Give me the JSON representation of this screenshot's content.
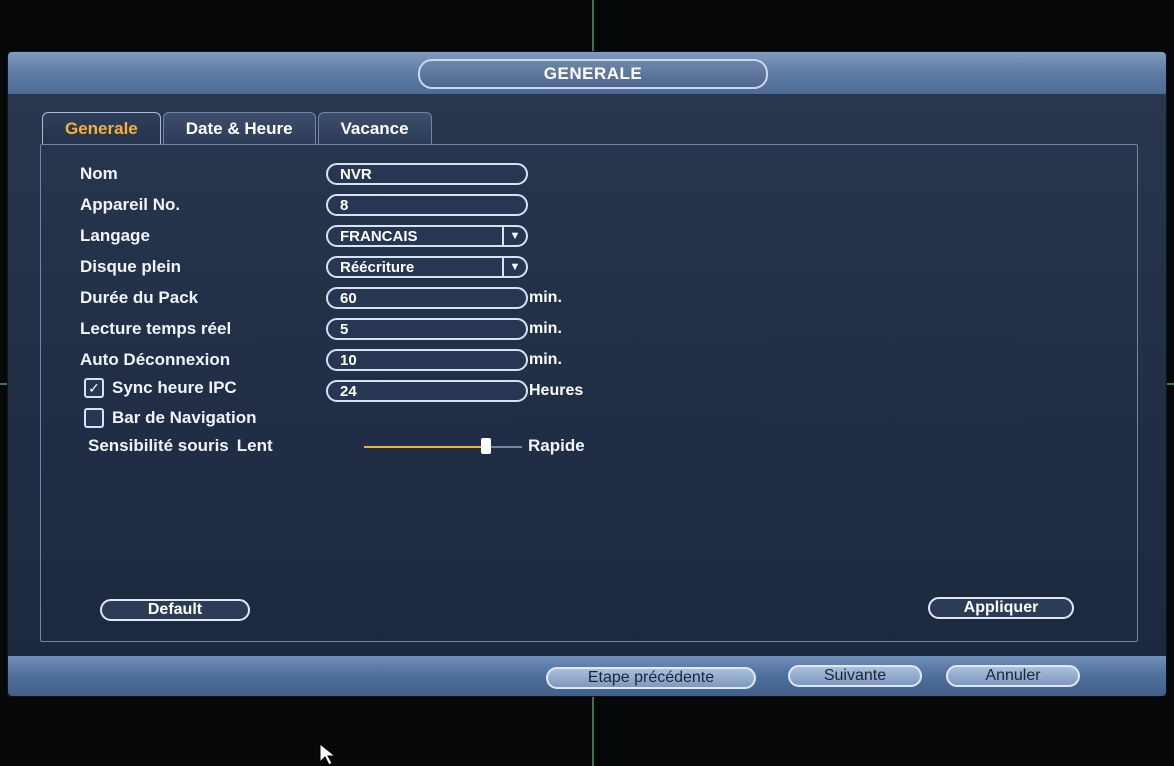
{
  "window": {
    "title": "GENERALE"
  },
  "tabs": [
    {
      "label": "Generale",
      "active": true
    },
    {
      "label": "Date & Heure",
      "active": false
    },
    {
      "label": "Vacance",
      "active": false
    }
  ],
  "form": {
    "nom": {
      "label": "Nom",
      "value": "NVR"
    },
    "appareil": {
      "label": "Appareil No.",
      "value": "8"
    },
    "langage": {
      "label": "Langage",
      "value": "FRANCAIS"
    },
    "disque": {
      "label": "Disque plein",
      "value": "Réécriture"
    },
    "pack": {
      "label": "Durée du Pack",
      "value": "60",
      "unit": "min."
    },
    "lecture": {
      "label": "Lecture temps réel",
      "value": "5",
      "unit": "min."
    },
    "deconnexion": {
      "label": "Auto Déconnexion",
      "value": "10",
      "unit": "min."
    },
    "sync": {
      "label": "Sync heure IPC",
      "value": "24",
      "unit": "Heures",
      "checked": true
    },
    "navbar": {
      "label": "Bar de Navigation",
      "checked": false
    },
    "mouse": {
      "label": "Sensibilité souris",
      "min_label": "Lent",
      "max_label": "Rapide",
      "level": 0.77
    }
  },
  "buttons": {
    "default": "Default",
    "apply": "Appliquer",
    "previous": "Etape précédente",
    "next": "Suivante",
    "cancel": "Annuler"
  },
  "icons": {
    "dropdown": "chevron-down-icon",
    "checkmark": "checkmark-icon",
    "cursor": "mouse-pointer-icon"
  },
  "colors": {
    "accent": "#f2b23a",
    "window_bg": "#24324a",
    "bar": "#5f7ea6"
  }
}
